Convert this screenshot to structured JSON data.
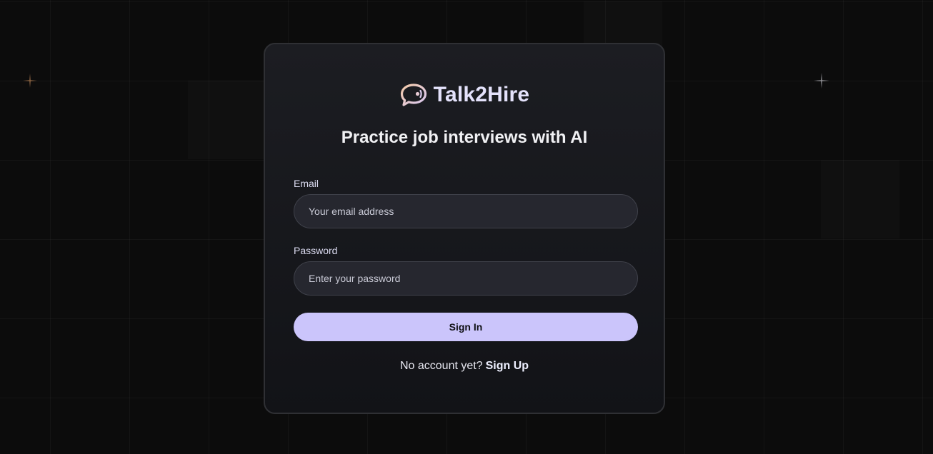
{
  "brand": {
    "name": "Talk2Hire",
    "logo_icon": "chat-bubble-icon"
  },
  "tagline": "Practice job interviews with AI",
  "form": {
    "email": {
      "label": "Email",
      "placeholder": "Your email address",
      "value": ""
    },
    "password": {
      "label": "Password",
      "placeholder": "Enter your password",
      "value": ""
    },
    "submit_label": "Sign In"
  },
  "footer": {
    "prompt": "No account yet?",
    "link_label": "Sign Up"
  },
  "colors": {
    "accent": "#cbc5fb",
    "brand_text": "#e4e2fb",
    "logo_gradient_start": "#f3c9a8",
    "logo_gradient_end": "#d9c9f2"
  }
}
